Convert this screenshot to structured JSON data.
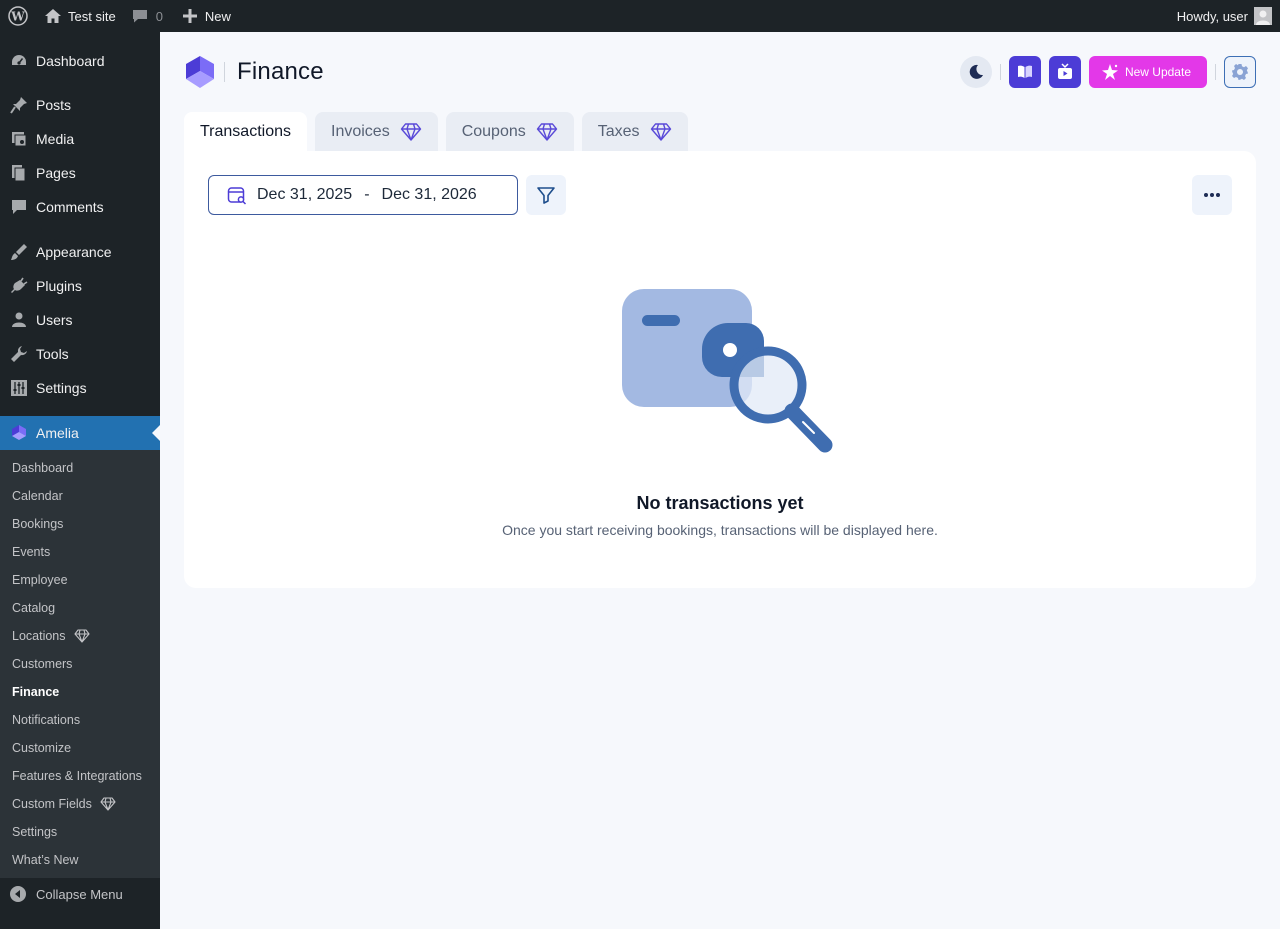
{
  "adminbar": {
    "site_name": "Test site",
    "comments_count": "0",
    "new_label": "New",
    "greeting": "Howdy, user"
  },
  "sidebar": {
    "items": [
      {
        "label": "Dashboard",
        "icon": "dashboard-icon"
      },
      {
        "label": "Posts",
        "icon": "pin-icon"
      },
      {
        "label": "Media",
        "icon": "media-icon"
      },
      {
        "label": "Pages",
        "icon": "pages-icon"
      },
      {
        "label": "Comments",
        "icon": "comment-icon"
      },
      {
        "label": "Appearance",
        "icon": "brush-icon"
      },
      {
        "label": "Plugins",
        "icon": "plug-icon"
      },
      {
        "label": "Users",
        "icon": "user-icon"
      },
      {
        "label": "Tools",
        "icon": "wrench-icon"
      },
      {
        "label": "Settings",
        "icon": "sliders-icon"
      },
      {
        "label": "Amelia",
        "icon": "amelia-icon"
      }
    ],
    "submenu": [
      {
        "label": "Dashboard"
      },
      {
        "label": "Calendar"
      },
      {
        "label": "Bookings"
      },
      {
        "label": "Events"
      },
      {
        "label": "Employee"
      },
      {
        "label": "Catalog"
      },
      {
        "label": "Locations",
        "premium": true
      },
      {
        "label": "Customers"
      },
      {
        "label": "Finance",
        "current": true
      },
      {
        "label": "Notifications"
      },
      {
        "label": "Customize"
      },
      {
        "label": "Features & Integrations"
      },
      {
        "label": "Custom Fields",
        "premium": true
      },
      {
        "label": "Settings"
      },
      {
        "label": "What’s New"
      }
    ],
    "collapse_label": "Collapse Menu"
  },
  "header": {
    "title": "Finance",
    "update_label": "New Update"
  },
  "tabs": [
    {
      "label": "Transactions",
      "active": true
    },
    {
      "label": "Invoices",
      "premium": true
    },
    {
      "label": "Coupons",
      "premium": true
    },
    {
      "label": "Taxes",
      "premium": true
    }
  ],
  "filters": {
    "date_start": "Dec 31, 2025",
    "date_separator": "-",
    "date_end": "Dec 31, 2026"
  },
  "empty_state": {
    "title": "No transactions yet",
    "description": "Once you start receiving bookings, transactions will be displayed here."
  },
  "colors": {
    "admin_dark": "#1d2327",
    "active_menu": "#2271b1",
    "brand_purple": "#4c3cd6",
    "update_pink": "#e338e8",
    "illustration_light": "#a3b9e2",
    "illustration_dark": "#3f6db0"
  }
}
